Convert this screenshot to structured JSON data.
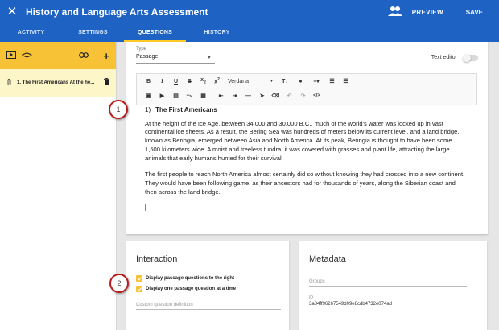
{
  "header": {
    "title": "History and Language Arts Assessment",
    "preview": "PREVIEW",
    "save": "SAVE"
  },
  "tabs": [
    {
      "label": "ACTIVITY",
      "active": false
    },
    {
      "label": "SETTINGS",
      "active": false
    },
    {
      "label": "QUESTIONS",
      "active": true
    },
    {
      "label": "HISTORY",
      "active": false
    }
  ],
  "sidebar": {
    "item_label": "1. The First Americans At the he...",
    "accent": "#f7c236"
  },
  "editor": {
    "type_label": "Type",
    "type_value": "Passage",
    "text_editor_label": "Text editor",
    "font_value": "Verdana",
    "question_number": "1)",
    "question_title": "The First Americans",
    "para1": "At the height of the Ice Age, between 34,000 and 30,000 B.C., much of the world's water was locked up in vast continental ice sheets. As a result, the Bering Sea was hundreds of meters below its current level, and a land bridge, known as Beringia, emerged between Asia and North America. At its peak, Beringia is thought to have been some 1,500 kilometers wide. A moist and treeless tundra, it was covered with grasses and plant life, attracting the large animals that early humans hunted for their survival.",
    "para2": "The first people to reach North America almost certainly did so without knowing they had crossed into a new continent. They would have been following game, as their ancestors had for thousands of years, along the Siberian coast and then across the land bridge."
  },
  "markers": {
    "m1": "1",
    "m2": "2"
  },
  "interaction": {
    "title": "Interaction",
    "option1": "Display passage questions to the right",
    "option2": "Display one passage question at a time",
    "custom_placeholder": "Custom question definition"
  },
  "metadata": {
    "title": "Metadata",
    "groups_placeholder": "Groups",
    "id_label": "ID",
    "id_value": "3a84ff96267549d09e8cdb4732e074ad"
  },
  "colors": {
    "header": "#1e63c3",
    "accent": "#f7c236",
    "marker": "#b71c1c"
  }
}
